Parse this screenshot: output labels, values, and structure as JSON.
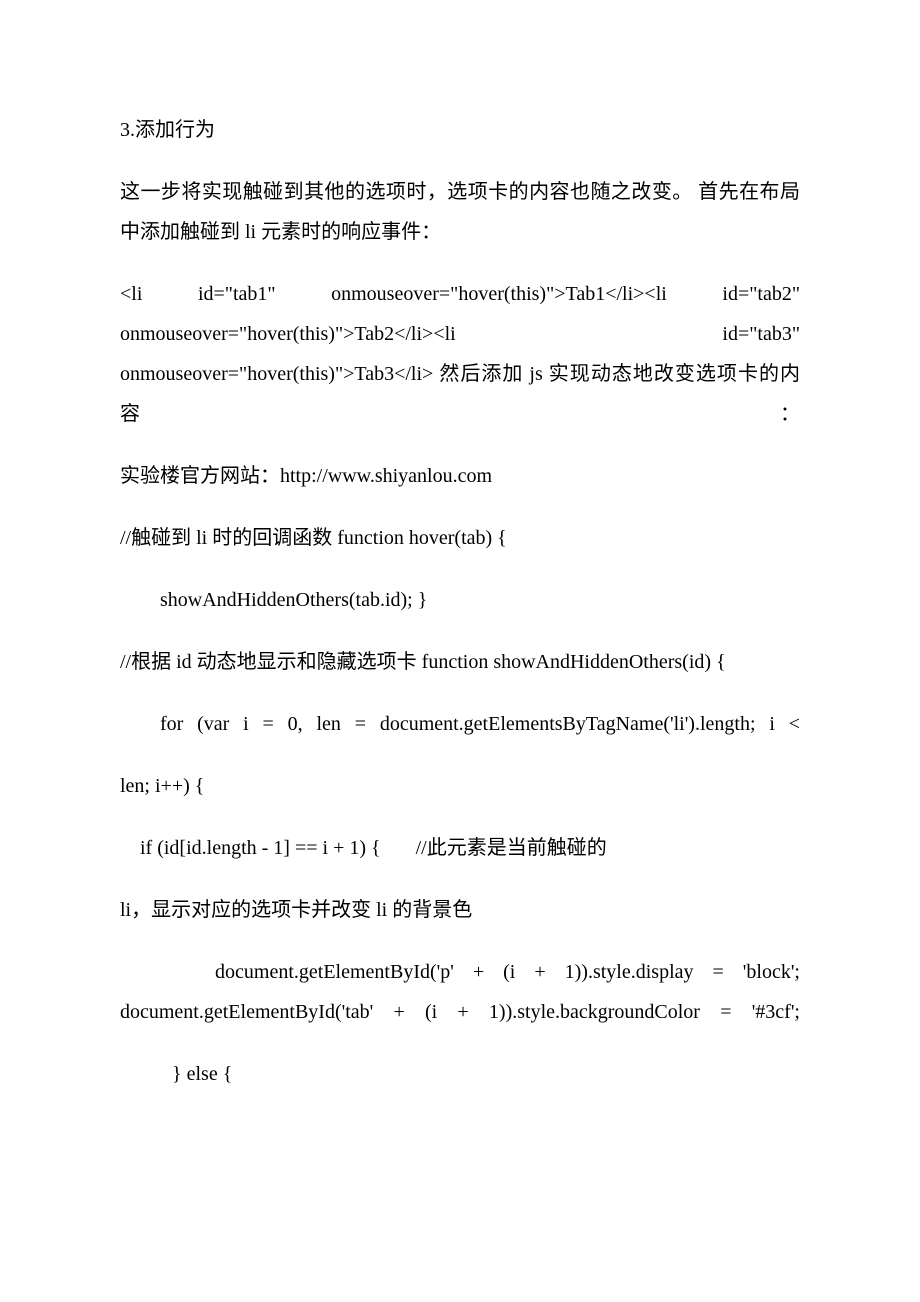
{
  "p1": "3.添加行为",
  "p2": "这一步将实现触碰到其他的选项时，选项卡的内容也随之改变。 首先在布局中添加触碰到 li 元素时的响应事件：",
  "p3": "<li id=\"tab1\" onmouseover=\"hover(this)\">Tab1</li><li id=\"tab2\" onmouseover=\"hover(this)\">Tab2</li><li id=\"tab3\" onmouseover=\"hover(this)\">Tab3</li> 然后添加 js 实现动态地改变选项卡的内容：",
  "p4": "实验楼官方网站：http://www.shiyanlou.com",
  "p5": "//触碰到 li 时的回调函数 function hover(tab) {",
  "p6": "showAndHiddenOthers(tab.id); }",
  "p7": "//根据 id 动态地显示和隐藏选项卡 function showAndHiddenOthers(id) {",
  "p8": "for (var i = 0, len = document.getElementsByTagName('li').length; i <",
  "p9": "len; i++) {",
  "p10": "    if (id[id.length - 1] == i + 1) {       //此元素是当前触碰的",
  "p11": "li，显示对应的选项卡并改变 li 的背景色",
  "p12": "     document.getElementById('p' + (i + 1)).style.display = 'block';            document.getElementById('tab' + (i + 1)).style.backgroundColor = '#3cf';",
  "p13": "} else {"
}
